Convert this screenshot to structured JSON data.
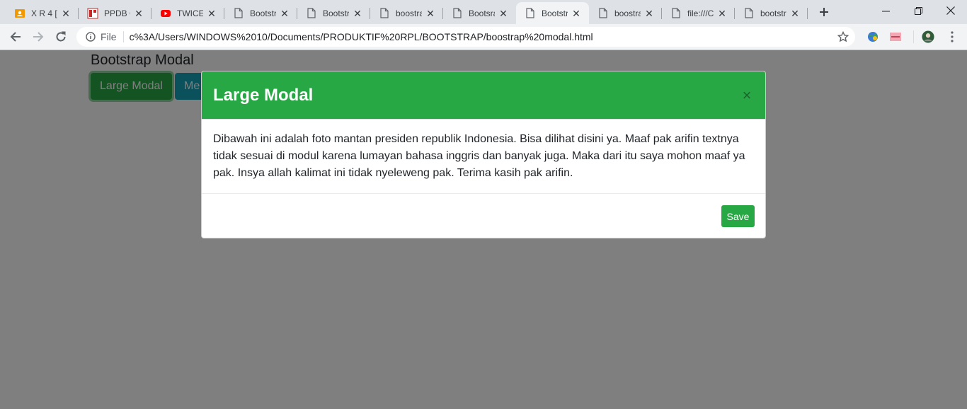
{
  "browser": {
    "tabs": [
      {
        "title": "X R 4 [",
        "icon": "classroom-icon",
        "active": false
      },
      {
        "title": "PPDB C",
        "icon": "ppdb-icon",
        "active": false
      },
      {
        "title": "TWICE",
        "icon": "youtube-icon",
        "active": false
      },
      {
        "title": "Bootstr",
        "icon": "file-icon",
        "active": false
      },
      {
        "title": "Bootstr",
        "icon": "file-icon",
        "active": false
      },
      {
        "title": "boostra",
        "icon": "file-icon",
        "active": false
      },
      {
        "title": "Bootsra",
        "icon": "file-icon",
        "active": false
      },
      {
        "title": "Bootstr",
        "icon": "file-icon",
        "active": true
      },
      {
        "title": "boostra",
        "icon": "file-icon",
        "active": false
      },
      {
        "title": "file:///C",
        "icon": "file-icon",
        "active": false
      },
      {
        "title": "bootstr",
        "icon": "file-icon",
        "active": false
      }
    ],
    "close_glyph": "✕",
    "address": {
      "scheme_label": "File",
      "url": "c%3A/Users/WINDOWS%2010/Documents/PRODUKTIF%20RPL/BOOTSTRAP/boostrap%20modal.html"
    }
  },
  "page": {
    "heading": "Bootstrap Modal",
    "buttons": {
      "large": "Large Modal",
      "medium": "Me"
    }
  },
  "modal": {
    "title": "Large Modal",
    "close": "×",
    "body": "Dibawah ini adalah foto mantan presiden republik Indonesia. Bisa dilihat disini ya. Maaf pak arifin textnya tidak sesuai di modul karena lumayan bahasa inggris dan banyak juga. Maka dari itu saya mohon maaf ya pak. Insya allah kalimat ini tidak nyeleweng pak. Terima kasih pak arifin.",
    "save": "Save"
  },
  "colors": {
    "success": "#28a745",
    "info": "#17a2b8",
    "backdrop": "#808080"
  }
}
